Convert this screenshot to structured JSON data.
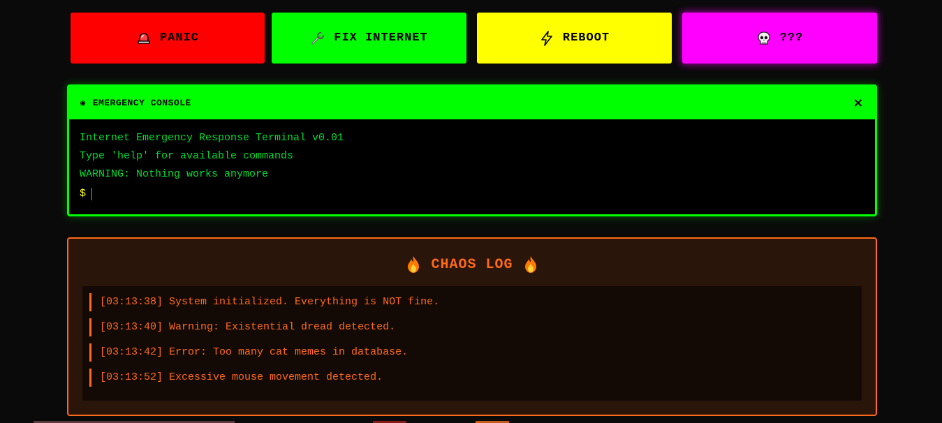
{
  "buttons": {
    "panic": {
      "label": "PANIC",
      "icon": "siren-icon",
      "color": "#ff0000"
    },
    "fix": {
      "label": "FIX INTERNET",
      "icon": "wrench-icon",
      "color": "#00ff00"
    },
    "reboot": {
      "label": "REBOOT",
      "icon": "lightning-icon",
      "color": "#ffff00"
    },
    "mystery": {
      "label": "???",
      "icon": "skull-icon",
      "color": "#ff00ff"
    }
  },
  "console": {
    "title": "EMERGENCY CONSOLE",
    "close_label": "×",
    "lines": [
      "Internet Emergency Response Terminal v0.01",
      "Type 'help' for available commands",
      "WARNING: Nothing works anymore"
    ],
    "prompt": "$",
    "input_value": "",
    "accent": "#00ff00"
  },
  "chaos_log": {
    "title": "CHAOS LOG",
    "icon": "fire-icon",
    "accent": "#ff6a1a",
    "entries": [
      "[03:13:38] System initialized. Everything is NOT fine.",
      "[03:13:40] Warning: Existential dread detected.",
      "[03:13:42] Error: Too many cat memes in database.",
      "[03:13:52] Excessive mouse movement detected."
    ]
  }
}
